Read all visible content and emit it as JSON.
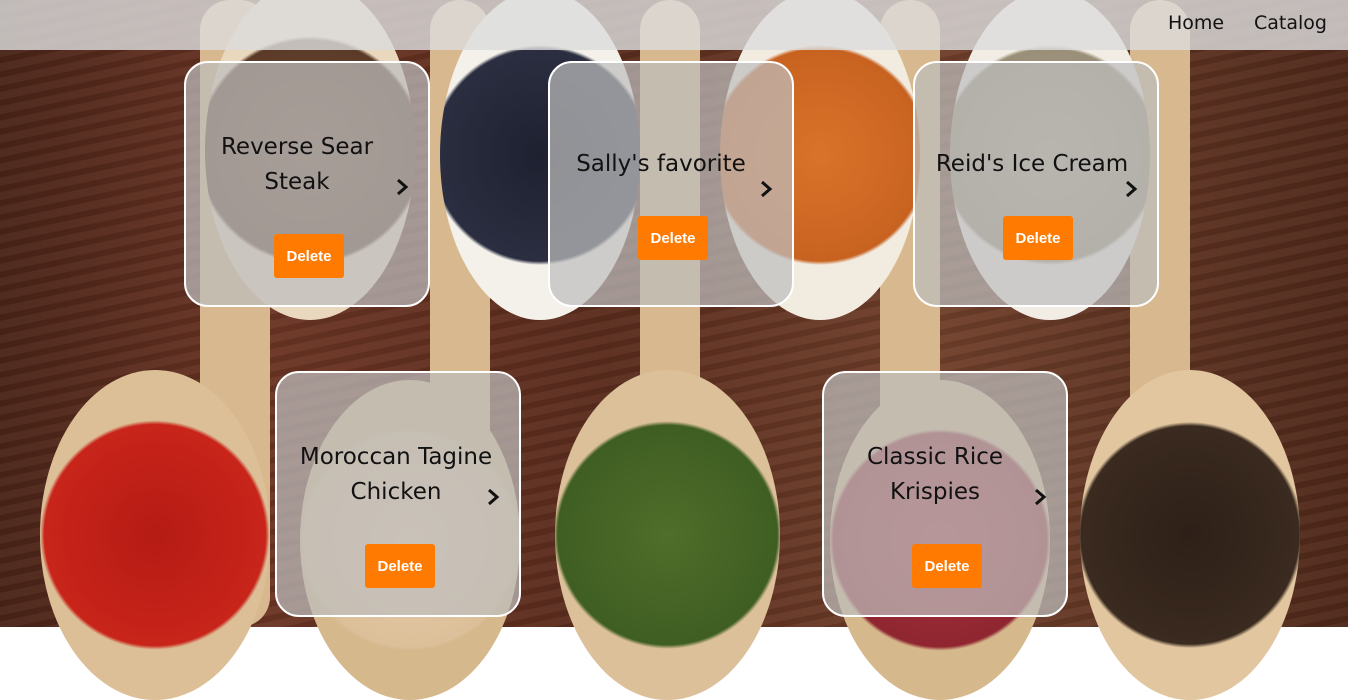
{
  "nav": {
    "home_label": "Home",
    "catalog_label": "Catalog"
  },
  "recipes": [
    {
      "title": "Reverse Sear Steak",
      "delete_label": "Delete"
    },
    {
      "title": "Sally's favorite",
      "delete_label": "Delete"
    },
    {
      "title": "Reid's Ice Cream",
      "delete_label": "Delete"
    },
    {
      "title": "Moroccan Tagine Chicken",
      "delete_label": "Delete"
    },
    {
      "title": "Classic Rice Krispies",
      "delete_label": "Delete"
    }
  ],
  "colors": {
    "accent": "#ff7a00",
    "card_border": "#ffffff"
  }
}
